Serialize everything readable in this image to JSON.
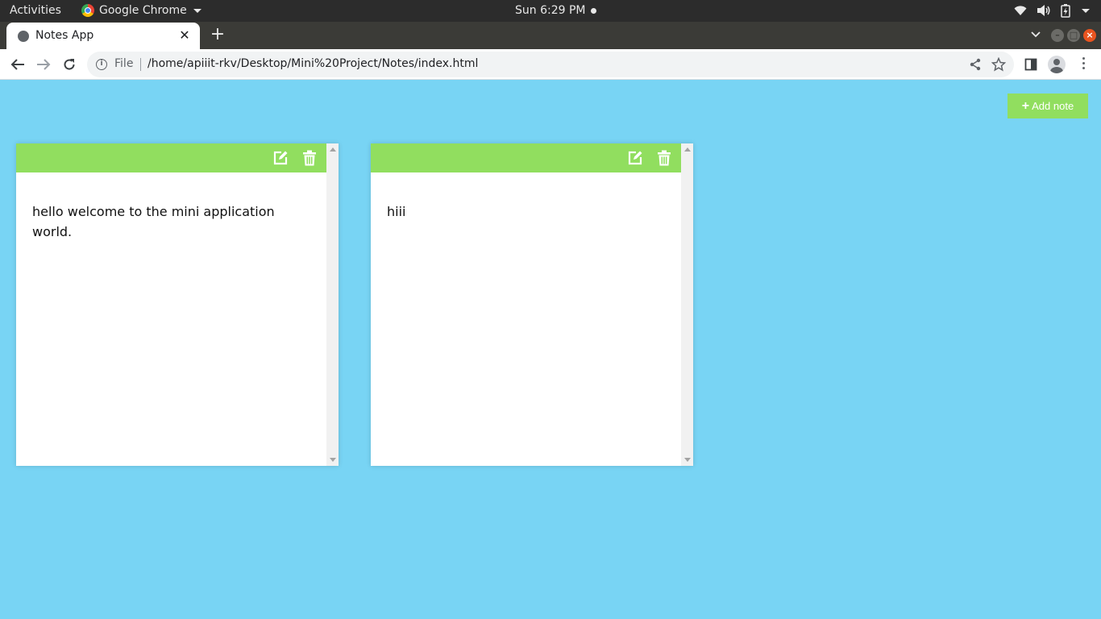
{
  "system_bar": {
    "activities": "Activities",
    "app_name": "Google Chrome",
    "clock": "Sun  6:29 PM"
  },
  "browser": {
    "tab_title": "Notes App",
    "tab_close": "✕",
    "new_tab": "+",
    "scheme": "File",
    "url": "/home/apiiit-rkv/Desktop/Mini%20Project/Notes/index.html",
    "info_symbol": "i"
  },
  "page": {
    "add_button_plus": "+",
    "add_button_label": "Add note",
    "notes": [
      {
        "text": "hello welcome to the mini application world."
      },
      {
        "text": "hiii"
      }
    ]
  },
  "colors": {
    "page_background": "#78d4f4",
    "accent_green": "#91de5f"
  }
}
